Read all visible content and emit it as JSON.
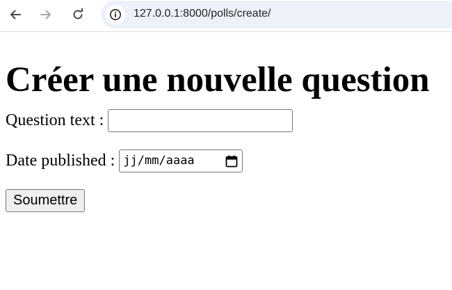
{
  "browser": {
    "back_icon": "arrow-left-icon",
    "forward_icon": "arrow-right-icon",
    "reload_icon": "reload-icon",
    "site_info_icon": "info-icon",
    "url": "127.0.0.1:8000/polls/create/",
    "omnibox_color": "#edf2fa"
  },
  "page": {
    "title": "Créer une nouvelle question",
    "question_label": "Question text :",
    "question_value": "",
    "date_label": "Date published :",
    "date_placeholder": "jj/mm/aaaa",
    "calendar_icon": "calendar-icon",
    "submit_label": "Soumettre"
  }
}
